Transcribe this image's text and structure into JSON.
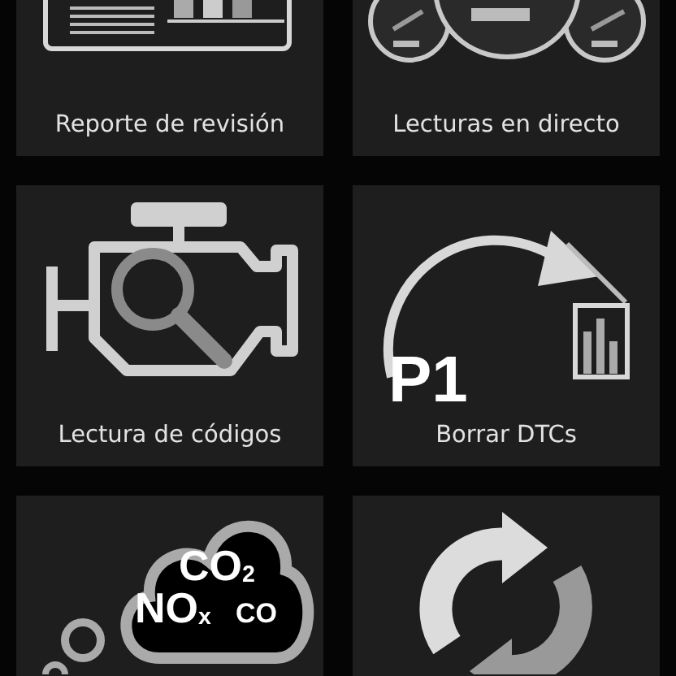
{
  "tiles": [
    {
      "kind": "report",
      "label": "Reporte de revisión"
    },
    {
      "kind": "gauges",
      "label": "Lecturas en directo"
    },
    {
      "kind": "engine",
      "label": "Lectura de códigos"
    },
    {
      "kind": "erase",
      "label": "Borrar DTCs",
      "icon_text": [
        "P1"
      ]
    },
    {
      "kind": "emissions",
      "icon_text": [
        "CO$_{2}$",
        "NO$_{x}$",
        "CO"
      ]
    },
    {
      "kind": "refresh"
    }
  ]
}
